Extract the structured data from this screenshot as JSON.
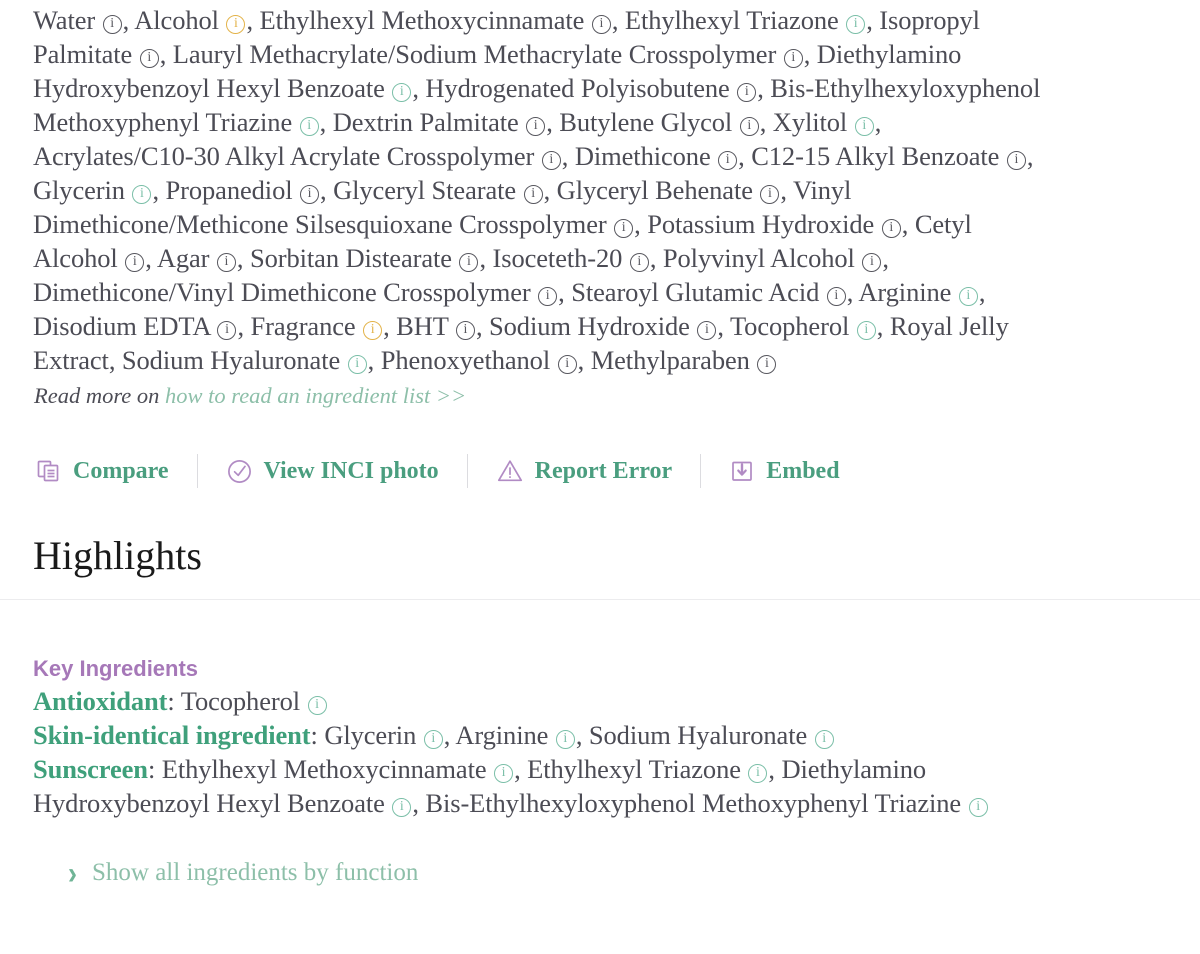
{
  "colors": {
    "body_text": "#4c4c55",
    "teal_icon": "#7bbfa8",
    "amber_icon": "#e3b34a",
    "gray_icon": "#58585f",
    "action_label_green": "#4a9e7f",
    "action_icon_purple": "#b18bc4",
    "link_green": "#8dbfa9",
    "key_ingredients_purple": "#a678b8",
    "category_green": "#3fa07b",
    "heading_black": "#1a1a1a",
    "divider": "#ececee"
  },
  "inci": {
    "items": [
      {
        "name": "Water",
        "icon": "info-icon",
        "icon_color": "gray"
      },
      {
        "name": "Alcohol",
        "icon": "info-icon",
        "icon_color": "amber"
      },
      {
        "name": "Ethylhexyl Methoxycinnamate",
        "icon": "info-icon",
        "icon_color": "gray"
      },
      {
        "name": "Ethylhexyl Triazone",
        "icon": "info-icon",
        "icon_color": "teal"
      },
      {
        "name": "Isopropyl Palmitate",
        "icon": "info-icon",
        "icon_color": "gray"
      },
      {
        "name": "Lauryl Methacrylate/Sodium Methacrylate Crosspolymer",
        "icon": "info-icon",
        "icon_color": "gray"
      },
      {
        "name": "Diethylamino Hydroxybenzoyl Hexyl Benzoate",
        "icon": "info-icon",
        "icon_color": "teal"
      },
      {
        "name": "Hydrogenated Polyisobutene",
        "icon": "info-icon",
        "icon_color": "gray"
      },
      {
        "name": "Bis-Ethylhexyloxyphenol Methoxyphenyl Triazine",
        "icon": "info-icon",
        "icon_color": "teal"
      },
      {
        "name": "Dextrin Palmitate",
        "icon": "info-icon",
        "icon_color": "gray"
      },
      {
        "name": "Butylene Glycol",
        "icon": "info-icon",
        "icon_color": "gray"
      },
      {
        "name": "Xylitol",
        "icon": "info-icon",
        "icon_color": "teal"
      },
      {
        "name": "Acrylates/C10-30 Alkyl Acrylate Crosspolymer",
        "icon": "info-icon",
        "icon_color": "gray"
      },
      {
        "name": "Dimethicone",
        "icon": "info-icon",
        "icon_color": "gray"
      },
      {
        "name": "C12-15 Alkyl Benzoate",
        "icon": "info-icon",
        "icon_color": "gray"
      },
      {
        "name": "Glycerin",
        "icon": "info-icon",
        "icon_color": "teal"
      },
      {
        "name": "Propanediol",
        "icon": "info-icon",
        "icon_color": "gray"
      },
      {
        "name": "Glyceryl Stearate",
        "icon": "info-icon",
        "icon_color": "gray"
      },
      {
        "name": "Glyceryl Behenate",
        "icon": "info-icon",
        "icon_color": "gray"
      },
      {
        "name": "Vinyl Dimethicone/Methicone Silsesquioxane Crosspolymer",
        "icon": "info-icon",
        "icon_color": "gray"
      },
      {
        "name": "Potassium Hydroxide",
        "icon": "info-icon",
        "icon_color": "gray"
      },
      {
        "name": "Cetyl Alcohol",
        "icon": "info-icon",
        "icon_color": "gray"
      },
      {
        "name": "Agar",
        "icon": "info-icon",
        "icon_color": "gray"
      },
      {
        "name": "Sorbitan Distearate",
        "icon": "info-icon",
        "icon_color": "gray"
      },
      {
        "name": "Isoceteth-20",
        "icon": "info-icon",
        "icon_color": "gray"
      },
      {
        "name": "Polyvinyl Alcohol",
        "icon": "info-icon",
        "icon_color": "gray"
      },
      {
        "name": "Dimethicone/Vinyl Dimethicone Crosspolymer",
        "icon": "info-icon",
        "icon_color": "gray"
      },
      {
        "name": "Stearoyl Glutamic Acid",
        "icon": "info-icon",
        "icon_color": "gray"
      },
      {
        "name": "Arginine",
        "icon": "info-icon",
        "icon_color": "teal"
      },
      {
        "name": "Disodium EDTA",
        "icon": "info-icon",
        "icon_color": "gray"
      },
      {
        "name": "Fragrance",
        "icon": "info-icon",
        "icon_color": "amber"
      },
      {
        "name": "BHT",
        "icon": "info-icon",
        "icon_color": "gray"
      },
      {
        "name": "Sodium Hydroxide",
        "icon": "info-icon",
        "icon_color": "gray"
      },
      {
        "name": "Tocopherol",
        "icon": "info-icon",
        "icon_color": "teal"
      },
      {
        "name": "Royal Jelly Extract",
        "icon": null,
        "icon_color": null
      },
      {
        "name": "Sodium Hyaluronate",
        "icon": "info-icon",
        "icon_color": "teal"
      },
      {
        "name": "Phenoxyethanol",
        "icon": "info-icon",
        "icon_color": "gray"
      },
      {
        "name": "Methylparaben",
        "icon": "info-icon",
        "icon_color": "gray"
      }
    ],
    "read_more_prefix": "Read more on",
    "read_more_link": "how to read an ingredient list >>"
  },
  "actions": [
    {
      "label": "Compare",
      "icon": "copy-documents-icon"
    },
    {
      "label": "View INCI photo",
      "icon": "check-circle-icon"
    },
    {
      "label": "Report Error",
      "icon": "warning-triangle-icon"
    },
    {
      "label": "Embed",
      "icon": "download-box-icon"
    }
  ],
  "highlights": {
    "heading": "Highlights",
    "key_ingredients_title": "Key Ingredients",
    "groups": [
      {
        "category": "Antioxidant",
        "items": [
          {
            "name": "Tocopherol",
            "icon": "info-icon",
            "icon_color": "teal"
          }
        ]
      },
      {
        "category": "Skin-identical ingredient",
        "items": [
          {
            "name": "Glycerin",
            "icon": "info-icon",
            "icon_color": "teal"
          },
          {
            "name": "Arginine",
            "icon": "info-icon",
            "icon_color": "teal"
          },
          {
            "name": "Sodium Hyaluronate",
            "icon": "info-icon",
            "icon_color": "teal"
          }
        ]
      },
      {
        "category": "Sunscreen",
        "items": [
          {
            "name": "Ethylhexyl Methoxycinnamate",
            "icon": "info-icon",
            "icon_color": "teal"
          },
          {
            "name": "Ethylhexyl Triazone",
            "icon": "info-icon",
            "icon_color": "teal"
          },
          {
            "name": "Diethylamino Hydroxybenzoyl Hexyl Benzoate",
            "icon": "info-icon",
            "icon_color": "teal"
          },
          {
            "name": "Bis-Ethylhexyloxyphenol Methoxyphenyl Triazine",
            "icon": "info-icon",
            "icon_color": "teal"
          }
        ]
      }
    ],
    "show_all_label": "Show all ingredients by function",
    "show_all_icon": "chevron-right-icon"
  }
}
